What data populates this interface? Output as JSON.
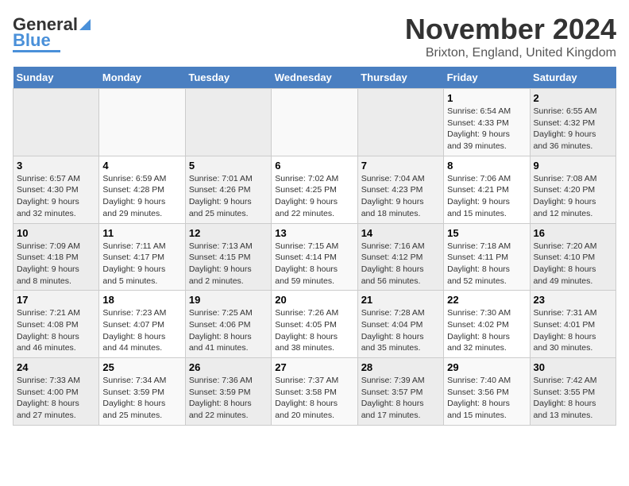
{
  "logo": {
    "text_general": "General",
    "text_blue": "Blue"
  },
  "title": "November 2024",
  "location": "Brixton, England, United Kingdom",
  "days_of_week": [
    "Sunday",
    "Monday",
    "Tuesday",
    "Wednesday",
    "Thursday",
    "Friday",
    "Saturday"
  ],
  "weeks": [
    [
      {
        "day": "",
        "info": ""
      },
      {
        "day": "",
        "info": ""
      },
      {
        "day": "",
        "info": ""
      },
      {
        "day": "",
        "info": ""
      },
      {
        "day": "",
        "info": ""
      },
      {
        "day": "1",
        "info": "Sunrise: 6:54 AM\nSunset: 4:33 PM\nDaylight: 9 hours\nand 39 minutes."
      },
      {
        "day": "2",
        "info": "Sunrise: 6:55 AM\nSunset: 4:32 PM\nDaylight: 9 hours\nand 36 minutes."
      }
    ],
    [
      {
        "day": "3",
        "info": "Sunrise: 6:57 AM\nSunset: 4:30 PM\nDaylight: 9 hours\nand 32 minutes."
      },
      {
        "day": "4",
        "info": "Sunrise: 6:59 AM\nSunset: 4:28 PM\nDaylight: 9 hours\nand 29 minutes."
      },
      {
        "day": "5",
        "info": "Sunrise: 7:01 AM\nSunset: 4:26 PM\nDaylight: 9 hours\nand 25 minutes."
      },
      {
        "day": "6",
        "info": "Sunrise: 7:02 AM\nSunset: 4:25 PM\nDaylight: 9 hours\nand 22 minutes."
      },
      {
        "day": "7",
        "info": "Sunrise: 7:04 AM\nSunset: 4:23 PM\nDaylight: 9 hours\nand 18 minutes."
      },
      {
        "day": "8",
        "info": "Sunrise: 7:06 AM\nSunset: 4:21 PM\nDaylight: 9 hours\nand 15 minutes."
      },
      {
        "day": "9",
        "info": "Sunrise: 7:08 AM\nSunset: 4:20 PM\nDaylight: 9 hours\nand 12 minutes."
      }
    ],
    [
      {
        "day": "10",
        "info": "Sunrise: 7:09 AM\nSunset: 4:18 PM\nDaylight: 9 hours\nand 8 minutes."
      },
      {
        "day": "11",
        "info": "Sunrise: 7:11 AM\nSunset: 4:17 PM\nDaylight: 9 hours\nand 5 minutes."
      },
      {
        "day": "12",
        "info": "Sunrise: 7:13 AM\nSunset: 4:15 PM\nDaylight: 9 hours\nand 2 minutes."
      },
      {
        "day": "13",
        "info": "Sunrise: 7:15 AM\nSunset: 4:14 PM\nDaylight: 8 hours\nand 59 minutes."
      },
      {
        "day": "14",
        "info": "Sunrise: 7:16 AM\nSunset: 4:12 PM\nDaylight: 8 hours\nand 56 minutes."
      },
      {
        "day": "15",
        "info": "Sunrise: 7:18 AM\nSunset: 4:11 PM\nDaylight: 8 hours\nand 52 minutes."
      },
      {
        "day": "16",
        "info": "Sunrise: 7:20 AM\nSunset: 4:10 PM\nDaylight: 8 hours\nand 49 minutes."
      }
    ],
    [
      {
        "day": "17",
        "info": "Sunrise: 7:21 AM\nSunset: 4:08 PM\nDaylight: 8 hours\nand 46 minutes."
      },
      {
        "day": "18",
        "info": "Sunrise: 7:23 AM\nSunset: 4:07 PM\nDaylight: 8 hours\nand 44 minutes."
      },
      {
        "day": "19",
        "info": "Sunrise: 7:25 AM\nSunset: 4:06 PM\nDaylight: 8 hours\nand 41 minutes."
      },
      {
        "day": "20",
        "info": "Sunrise: 7:26 AM\nSunset: 4:05 PM\nDaylight: 8 hours\nand 38 minutes."
      },
      {
        "day": "21",
        "info": "Sunrise: 7:28 AM\nSunset: 4:04 PM\nDaylight: 8 hours\nand 35 minutes."
      },
      {
        "day": "22",
        "info": "Sunrise: 7:30 AM\nSunset: 4:02 PM\nDaylight: 8 hours\nand 32 minutes."
      },
      {
        "day": "23",
        "info": "Sunrise: 7:31 AM\nSunset: 4:01 PM\nDaylight: 8 hours\nand 30 minutes."
      }
    ],
    [
      {
        "day": "24",
        "info": "Sunrise: 7:33 AM\nSunset: 4:00 PM\nDaylight: 8 hours\nand 27 minutes."
      },
      {
        "day": "25",
        "info": "Sunrise: 7:34 AM\nSunset: 3:59 PM\nDaylight: 8 hours\nand 25 minutes."
      },
      {
        "day": "26",
        "info": "Sunrise: 7:36 AM\nSunset: 3:59 PM\nDaylight: 8 hours\nand 22 minutes."
      },
      {
        "day": "27",
        "info": "Sunrise: 7:37 AM\nSunset: 3:58 PM\nDaylight: 8 hours\nand 20 minutes."
      },
      {
        "day": "28",
        "info": "Sunrise: 7:39 AM\nSunset: 3:57 PM\nDaylight: 8 hours\nand 17 minutes."
      },
      {
        "day": "29",
        "info": "Sunrise: 7:40 AM\nSunset: 3:56 PM\nDaylight: 8 hours\nand 15 minutes."
      },
      {
        "day": "30",
        "info": "Sunrise: 7:42 AM\nSunset: 3:55 PM\nDaylight: 8 hours\nand 13 minutes."
      }
    ]
  ]
}
